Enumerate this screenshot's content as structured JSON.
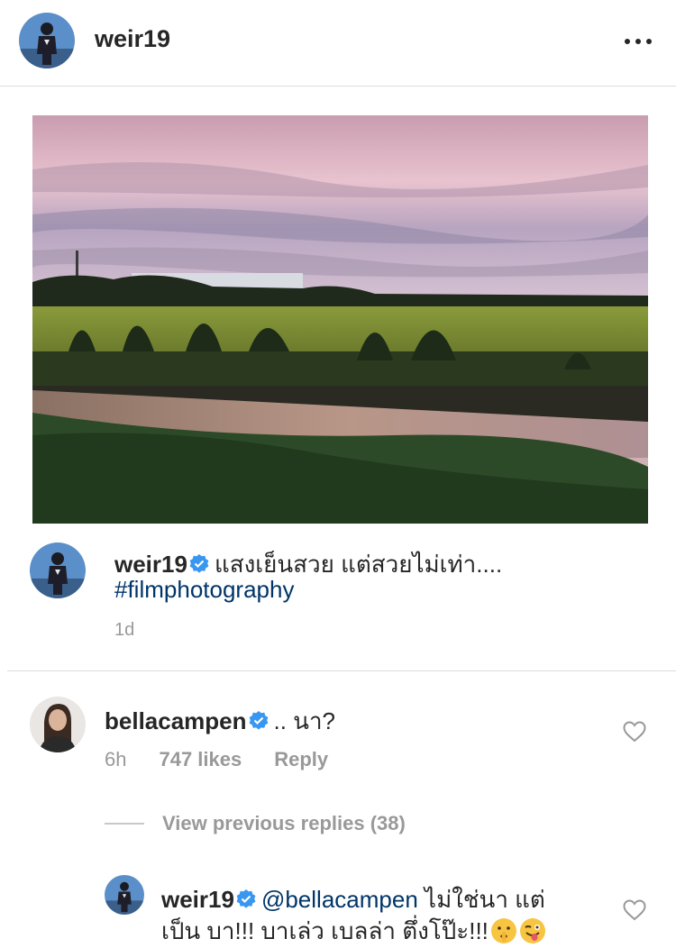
{
  "header": {
    "username": "weir19",
    "more_icon": "more-horizontal-icon"
  },
  "post": {
    "image_alt": "sunset over rice field with water reflection",
    "caption": {
      "username": "weir19",
      "text": "แสงเย็นสวย แต่สวยไม่เท่า....",
      "hashtag": "#filmphotography",
      "time": "1d"
    }
  },
  "comments": [
    {
      "username": "bellacampen",
      "text": ".. นา?",
      "time": "6h",
      "likes": "747 likes",
      "reply_label": "Reply"
    }
  ],
  "view_previous_replies": "View previous replies (38)",
  "reply": {
    "username": "weir19",
    "mention": "@bellacampen",
    "text_line1": " ไม่ใช่นา แต่",
    "text_line2": "เป็น บา!!! บาเล่ว เบลล่า ตึ่งโป๊ะ!!!"
  },
  "colors": {
    "accent_link": "#003569",
    "verified": "#3897f0",
    "secondary_text": "#999999"
  }
}
